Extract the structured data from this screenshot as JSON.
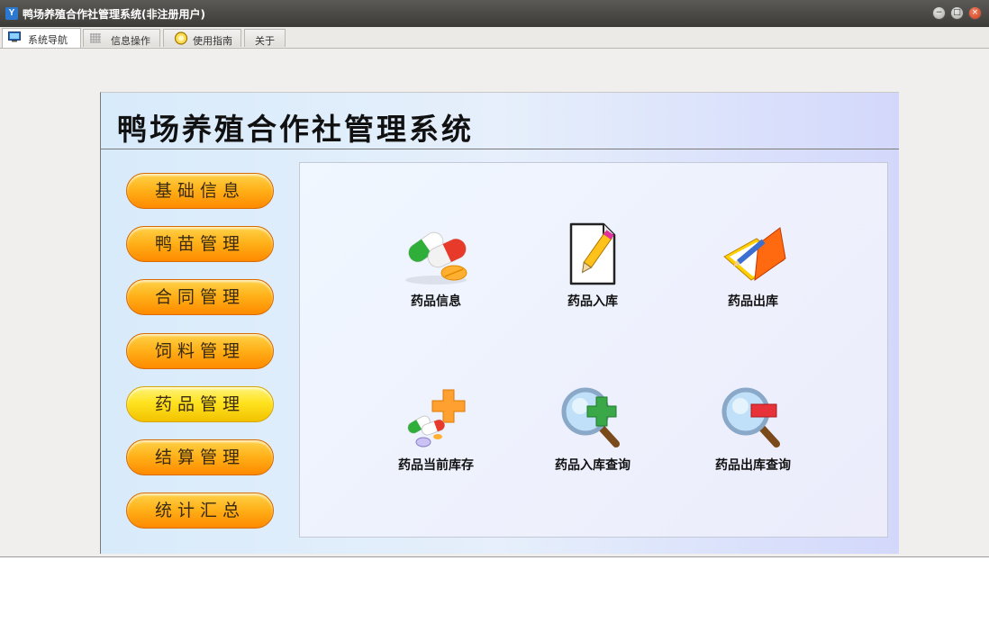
{
  "window": {
    "title": "鸭场养殖合作社管理系统(非注册用户)",
    "app_icon_letter": "Y",
    "controls": {
      "minimize": "−",
      "maximize": "□",
      "close": "×"
    }
  },
  "tabs": [
    {
      "label": "系统导航",
      "icon": "monitor-icon",
      "active": true
    },
    {
      "label": "信息操作",
      "icon": "grid-icon",
      "active": false
    },
    {
      "label": "使用指南",
      "icon": "help-icon",
      "active": false
    },
    {
      "label": "关于",
      "icon": "",
      "active": false
    }
  ],
  "panel": {
    "title": "鸭场养殖合作社管理系统"
  },
  "sidebar": {
    "items": [
      {
        "label": "基础信息",
        "active": false
      },
      {
        "label": "鸭苗管理",
        "active": false
      },
      {
        "label": "合同管理",
        "active": false
      },
      {
        "label": "饲料管理",
        "active": false
      },
      {
        "label": "药品管理",
        "active": true
      },
      {
        "label": "结算管理",
        "active": false
      },
      {
        "label": "统计汇总",
        "active": false
      }
    ]
  },
  "functions": [
    {
      "label": "药品信息",
      "icon": "pills-icon"
    },
    {
      "label": "药品入库",
      "icon": "document-edit-icon"
    },
    {
      "label": "药品出库",
      "icon": "folder-edit-icon"
    },
    {
      "label": "药品当前库存",
      "icon": "medicine-plus-icon"
    },
    {
      "label": "药品入库查询",
      "icon": "magnifier-plus-icon"
    },
    {
      "label": "药品出库查询",
      "icon": "magnifier-minus-icon"
    }
  ],
  "colors": {
    "menu_button": "#ff9e10",
    "menu_button_active": "#ffe320",
    "titlebar": "#4a4946"
  }
}
